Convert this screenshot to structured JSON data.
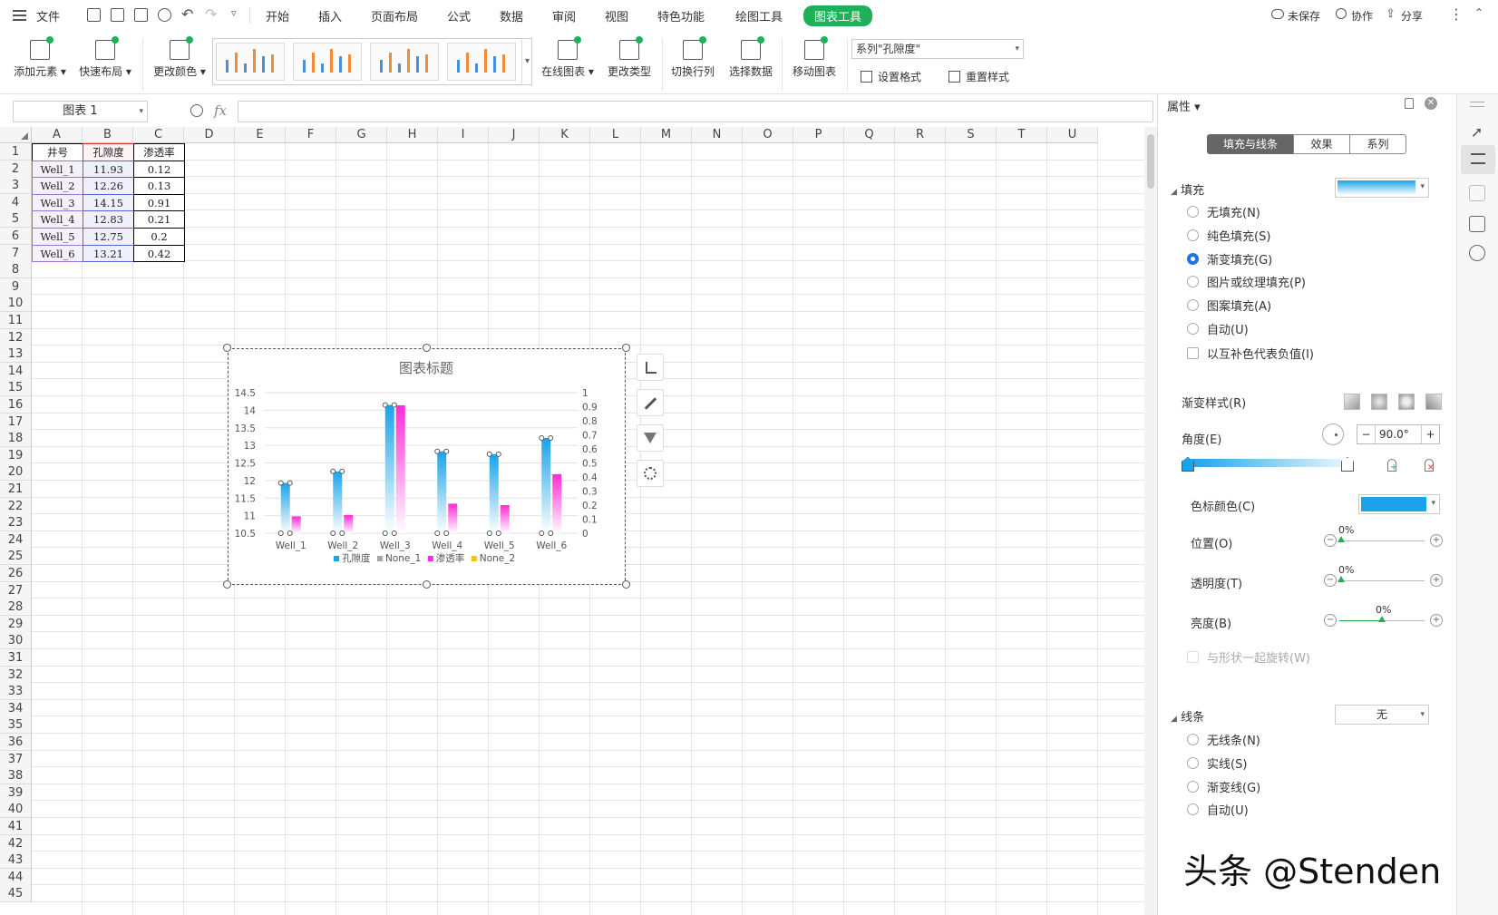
{
  "menubar": {
    "file": "文件",
    "tabs": [
      "开始",
      "插入",
      "页面布局",
      "公式",
      "数据",
      "审阅",
      "视图",
      "特色功能",
      "绘图工具",
      "图表工具"
    ],
    "active_tab": "图表工具",
    "unsaved": "未保存",
    "collab": "协作",
    "share": "分享"
  },
  "ribbon": {
    "add_element": "添加元素",
    "quick_layout": "快速布局",
    "change_color": "更改颜色",
    "online_chart": "在线图表",
    "change_type": "更改类型",
    "switch_rowcol": "切换行列",
    "select_data": "选择数据",
    "move_chart": "移动图表",
    "series_select": "系列\"孔隙度\"",
    "set_format": "设置格式",
    "reset_style": "重置样式"
  },
  "formulabar": {
    "namebox": "图表 1",
    "fx": "fx",
    "value": ""
  },
  "sheet": {
    "columns": [
      "A",
      "B",
      "C",
      "D",
      "E",
      "F",
      "G",
      "H",
      "I",
      "J",
      "K",
      "L",
      "M",
      "N",
      "O",
      "P",
      "Q",
      "R",
      "S",
      "T",
      "U"
    ],
    "rows": [
      "1",
      "2",
      "3",
      "4",
      "5",
      "6",
      "7",
      "8",
      "9",
      "10",
      "11",
      "12",
      "13",
      "14",
      "15",
      "16",
      "17",
      "18",
      "19",
      "20",
      "21",
      "22",
      "23",
      "24",
      "25",
      "26",
      "27",
      "28",
      "29",
      "30",
      "31",
      "32",
      "33",
      "34",
      "35",
      "36",
      "37",
      "38",
      "39",
      "40",
      "41",
      "42",
      "43",
      "44",
      "45"
    ],
    "table": {
      "headers": [
        "井号",
        "孔隙度",
        "渗透率"
      ],
      "rows": [
        [
          "Well_1",
          "11.93",
          "0.12"
        ],
        [
          "Well_2",
          "12.26",
          "0.13"
        ],
        [
          "Well_3",
          "14.15",
          "0.91"
        ],
        [
          "Well_4",
          "12.83",
          "0.21"
        ],
        [
          "Well_5",
          "12.75",
          "0.2"
        ],
        [
          "Well_6",
          "13.21",
          "0.42"
        ]
      ]
    }
  },
  "chart_data": {
    "type": "bar",
    "title": "图表标题",
    "categories": [
      "Well_1",
      "Well_2",
      "Well_3",
      "Well_4",
      "Well_5",
      "Well_6"
    ],
    "series": [
      {
        "name": "孔隙度",
        "axis": "left",
        "values": [
          11.93,
          12.26,
          14.15,
          12.83,
          12.75,
          13.21
        ],
        "color": "#1aa3e8"
      },
      {
        "name": "None_1",
        "axis": "left",
        "values": [],
        "color": "#a5a5a5"
      },
      {
        "name": "渗透率",
        "axis": "right",
        "values": [
          0.12,
          0.13,
          0.91,
          0.21,
          0.2,
          0.42
        ],
        "color": "#ff2bd6"
      },
      {
        "name": "None_2",
        "axis": "right",
        "values": [],
        "color": "#ffc000"
      }
    ],
    "y_left": {
      "min": 10.5,
      "max": 14.5,
      "ticks": [
        "14.5",
        "14",
        "13.5",
        "13",
        "12.5",
        "12",
        "11.5",
        "11",
        "10.5"
      ]
    },
    "y_right": {
      "min": 0,
      "max": 1,
      "ticks": [
        "1",
        "0.9",
        "0.8",
        "0.7",
        "0.6",
        "0.5",
        "0.4",
        "0.3",
        "0.2",
        "0.1",
        "0"
      ]
    },
    "legend_position": "bottom",
    "grid": true
  },
  "panel": {
    "title": "属性",
    "tabs": [
      "填充与线条",
      "效果",
      "系列"
    ],
    "fill_section": "填充",
    "fill_options": [
      "无填充(N)",
      "纯色填充(S)",
      "渐变填充(G)",
      "图片或纹理填充(P)",
      "图案填充(A)",
      "自动(U)"
    ],
    "fill_selected": "渐变填充(G)",
    "invert_negative": "以互补色代表负值(I)",
    "gradient_style": "渐变样式(R)",
    "angle_label": "角度(E)",
    "angle_value": "90.0°",
    "stop_color_label": "色标颜色(C)",
    "stop_color": "#1aa3e8",
    "position_label": "位置(O)",
    "position_value": "0%",
    "transparency_label": "透明度(T)",
    "transparency_value": "0%",
    "brightness_label": "亮度(B)",
    "brightness_value": "0%",
    "rotate_with_shape": "与形状一起旋转(W)",
    "line_section": "线条",
    "line_value": "无",
    "line_options": [
      "无线条(N)",
      "实线(S)",
      "渐变线(G)",
      "自动(U)"
    ]
  },
  "watermark": "头条 @Stenden"
}
